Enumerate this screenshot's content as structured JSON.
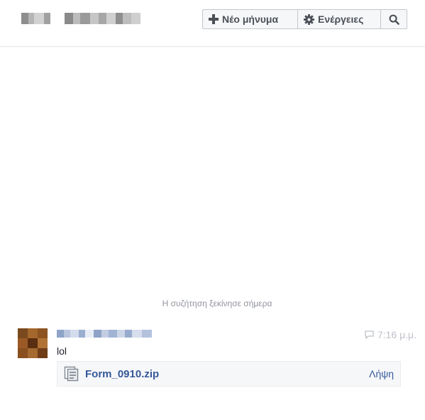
{
  "header": {
    "new_message_label": "Νέο μήνυμα",
    "actions_label": "Ενέργειες"
  },
  "thread": {
    "started_text": "Η συζήτηση ξεκίνησε σήμερα"
  },
  "message": {
    "time": "7:16 μ.μ.",
    "text": "lol",
    "attachment": {
      "filename": "Form_0910.zip",
      "download_label": "Λήψη"
    }
  },
  "colors": {
    "link": "#365899",
    "muted": "#90949c",
    "border": "#c4c6ca"
  },
  "icons": {
    "new": "plus-icon",
    "actions": "gear-icon",
    "search": "search-icon",
    "time": "chat-bubble-icon",
    "file": "file-icon"
  }
}
